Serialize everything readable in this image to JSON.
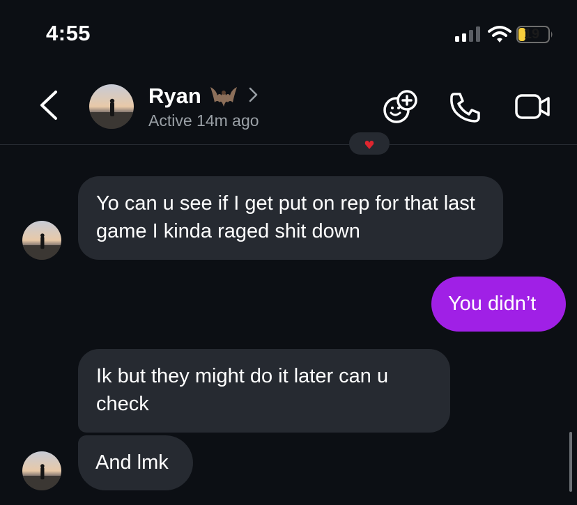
{
  "status_bar": {
    "time": "4:55",
    "battery": "19",
    "battery_color": "#f6cd3c"
  },
  "header": {
    "back_icon": "chevron-left-icon",
    "contact_name": "Ryan",
    "name_emoji": "bat",
    "active_status": "Active 14m ago",
    "actions": [
      "effects-icon",
      "phone-icon",
      "video-camera-icon"
    ]
  },
  "colors": {
    "background": "#0c0f14",
    "incoming_bubble": "#262a31",
    "outgoing_bubble": "#a020e6",
    "secondary_text": "#9aa0a6"
  },
  "messages": [
    {
      "direction": "incoming",
      "text": "Yo can u see if I get put on rep for that last game I kinda raged shit down"
    },
    {
      "direction": "outgoing",
      "text": "You didn’t"
    },
    {
      "direction": "incoming",
      "text": "Ik but they might do it later can u check"
    },
    {
      "direction": "incoming",
      "text": "And lmk"
    }
  ]
}
